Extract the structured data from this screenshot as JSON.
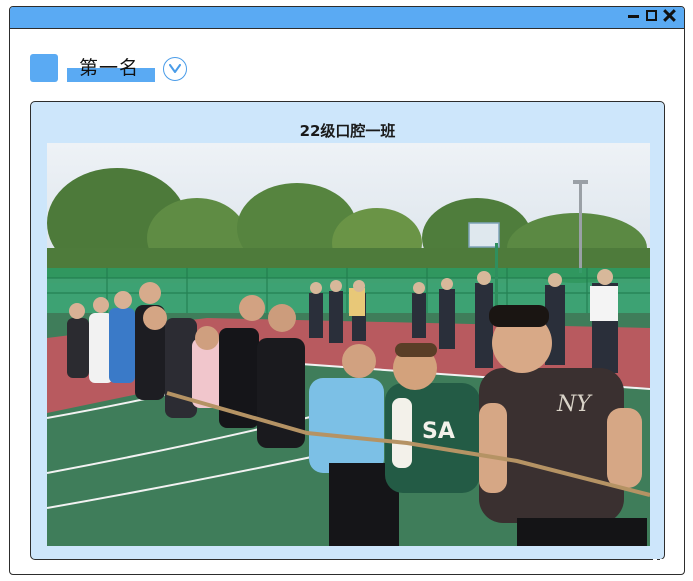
{
  "window": {
    "controls": [
      "minimize-icon",
      "maximize-icon",
      "close-icon"
    ]
  },
  "heading": {
    "title": "第一名",
    "expand_icon": "chevron-down-icon"
  },
  "card": {
    "title": "22级口腔一班"
  },
  "photo": {
    "jersey_text": "SA",
    "shirt_logo": "NY"
  },
  "colors": {
    "accent": "#5aaaf3",
    "card_bg": "#cde6fb",
    "border": "#2d2d2d"
  }
}
